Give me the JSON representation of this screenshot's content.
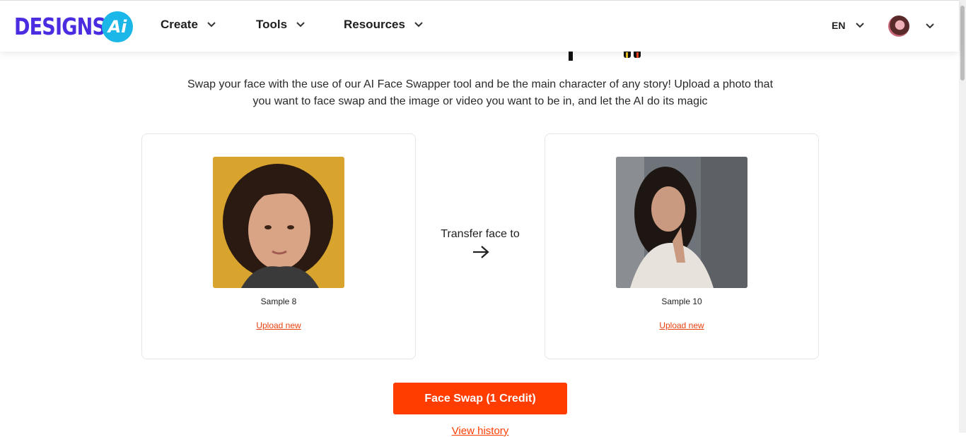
{
  "header": {
    "logo_text": "DESIGNS.",
    "logo_badge": "Ai",
    "nav": [
      {
        "label": "Create"
      },
      {
        "label": "Tools"
      },
      {
        "label": "Resources"
      }
    ],
    "language": "EN"
  },
  "main": {
    "description_line1": "Swap your face with the use of our AI Face Swapper tool and be the main character of any story! Upload a photo that",
    "description_line2": "you want to face swap and the image or video you want to be in, and let the AI do its magic",
    "source_card": {
      "sample_label": "Sample 8",
      "upload_label": "Upload new"
    },
    "target_card": {
      "sample_label": "Sample 10",
      "upload_label": "Upload new"
    },
    "transfer_label": "Transfer face to",
    "swap_button_label": "Face Swap (1 Credit)",
    "history_label": "View history"
  },
  "colors": {
    "accent": "#ff3d00",
    "link": "#e8410f",
    "logo_primary": "#4b2ce0",
    "logo_badge": "#1ab7e8"
  }
}
